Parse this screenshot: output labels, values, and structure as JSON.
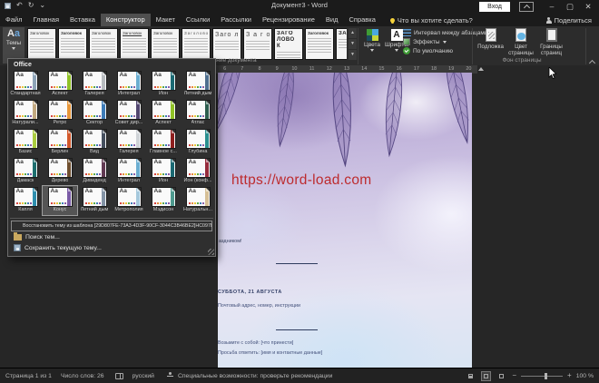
{
  "titlebar": {
    "title": "Документ3 - Word",
    "signin": "Вход"
  },
  "window_controls": {
    "minimize": "–",
    "maximize": "▢",
    "close": "✕"
  },
  "qat_glyphs": {
    "undo": "↶",
    "redo": "↻",
    "more": "⌄"
  },
  "tabs": [
    {
      "label": "Файл",
      "active": false
    },
    {
      "label": "Главная",
      "active": false
    },
    {
      "label": "Вставка",
      "active": false
    },
    {
      "label": "Конструктор",
      "active": true
    },
    {
      "label": "Макет",
      "active": false
    },
    {
      "label": "Ссылки",
      "active": false
    },
    {
      "label": "Рассылки",
      "active": false
    },
    {
      "label": "Рецензирование",
      "active": false
    },
    {
      "label": "Вид",
      "active": false
    },
    {
      "label": "Справка",
      "active": false
    }
  ],
  "tellme": "Что вы хотите сделать?",
  "share_label": "Поделиться",
  "ribbon": {
    "themes_label": "Темы",
    "style_gallery": [
      {
        "t": "Заголовок",
        "v": "plain"
      },
      {
        "t": "Заголовок",
        "v": "bold"
      },
      {
        "t": "Заголовок",
        "v": "plain"
      },
      {
        "t": "Заголовок",
        "v": "underline"
      },
      {
        "t": "Заголовок",
        "v": "plain"
      },
      {
        "t": "Заголовок",
        "v": "spread"
      },
      {
        "t": "Заго лово",
        "v": "big"
      },
      {
        "t": "З а г о л о",
        "v": "big"
      },
      {
        "t": "ЗАГО ЛОВО К",
        "v": "caps"
      },
      {
        "t": "Заголовок",
        "v": "bold"
      },
      {
        "t": "ЗАГОЛ",
        "v": "caps"
      }
    ],
    "colors_label": "Цвета",
    "fonts_label": "Шрифты",
    "paragraph_spacing": "Интервал между абзацами",
    "effects": "Эффекты",
    "default_label": "По умолчанию",
    "watermark": "Подложка",
    "page_color": "Цвет страницы",
    "page_borders": "Границы страниц",
    "group_page_bg": "Фон страницы",
    "group_doc_formatting": "Форматирование документа"
  },
  "themes_menu": {
    "header": "Office",
    "thumb_text": "Aa",
    "dot_palette": [
      "#d64541",
      "#e8893a",
      "#e8c63a",
      "#58a846",
      "#3e7cb8",
      "#8b5ba6"
    ],
    "items": [
      {
        "name": "Стандартная",
        "bar": "#8ea4b8"
      },
      {
        "name": "Аспект",
        "bar": "#90c226"
      },
      {
        "name": "Галерея",
        "bar": "#b8bcc0"
      },
      {
        "name": "Интеграл",
        "bar": "#6baed1"
      },
      {
        "name": "Ион",
        "bar": "#1b6a73"
      },
      {
        "name": "Летний дым",
        "bar": "#4f6f8f"
      },
      {
        "name": "Натурали...",
        "bar": "#c3a981"
      },
      {
        "name": "Ретро",
        "bar": "#e8973a"
      },
      {
        "name": "Сектор",
        "bar": "#3e7cb8"
      },
      {
        "name": "Совет дир...",
        "bar": "#514670"
      },
      {
        "name": "Аспект",
        "bar": "#90c226"
      },
      {
        "name": "Атлас",
        "bar": "#2c5d4e"
      },
      {
        "name": "Базис",
        "bar": "#aacc3f"
      },
      {
        "name": "Берлин",
        "bar": "#d3592c"
      },
      {
        "name": "Вид",
        "bar": "#46505f"
      },
      {
        "name": "Галерея",
        "bar": "#cfd3d7"
      },
      {
        "name": "Главное с...",
        "bar": "#8f1f1f"
      },
      {
        "name": "Глубина",
        "bar": "#2a8f8f"
      },
      {
        "name": "Дамаск",
        "bar": "#1e6f6f"
      },
      {
        "name": "Дерево",
        "bar": "#70502f"
      },
      {
        "name": "Дивиденд",
        "bar": "#613a52"
      },
      {
        "name": "Интеграл",
        "bar": "#6baed1"
      },
      {
        "name": "Ион",
        "bar": "#1b6a73"
      },
      {
        "name": "Ион (конф...",
        "bar": "#962b3c"
      },
      {
        "name": "Капля",
        "bar": "#2f8fae"
      },
      {
        "name": "Конус",
        "bar": "#7a5ba6",
        "selected": true
      },
      {
        "name": "Летний дым",
        "bar": "#8494a6"
      },
      {
        "name": "Метрополия",
        "bar": "#a5c8dc"
      },
      {
        "name": "Мэдисон",
        "bar": "#4e9a8e"
      },
      {
        "name": "Натуральн...",
        "bar": "#d6c096"
      }
    ],
    "restore": "Восстановить тему из шаблона [29D807FE-73A3-4D3F-90CF-3044C3B46BE2]HC097B815",
    "browse": "Поиск тем...",
    "save": "Сохранить текущую тему..."
  },
  "ruler": {
    "numbers": [
      "6",
      "7",
      "8",
      "9",
      "10",
      "11",
      "12",
      "13",
      "14",
      "15",
      "16",
      "17",
      "18",
      "19",
      "20"
    ]
  },
  "doc": {
    "url": "https://word-load.com",
    "fragment": "аздником!",
    "date": "СУББОТА, 21 АВГУСТА",
    "address": "Почтовый адрес, номер, инструкции",
    "bring": "Возьмите с собой: [что принести]",
    "rsvp": "Просьба ответить: [имя и контактные данные]"
  },
  "status": {
    "page": "Страница 1 из 1",
    "words": "Число слов: 26",
    "language": "русский",
    "accessibility": "Специальные возможности: проверьте рекомендации",
    "zoom": "100 %"
  },
  "colors": {
    "accent_red": "#bd2b2e"
  }
}
